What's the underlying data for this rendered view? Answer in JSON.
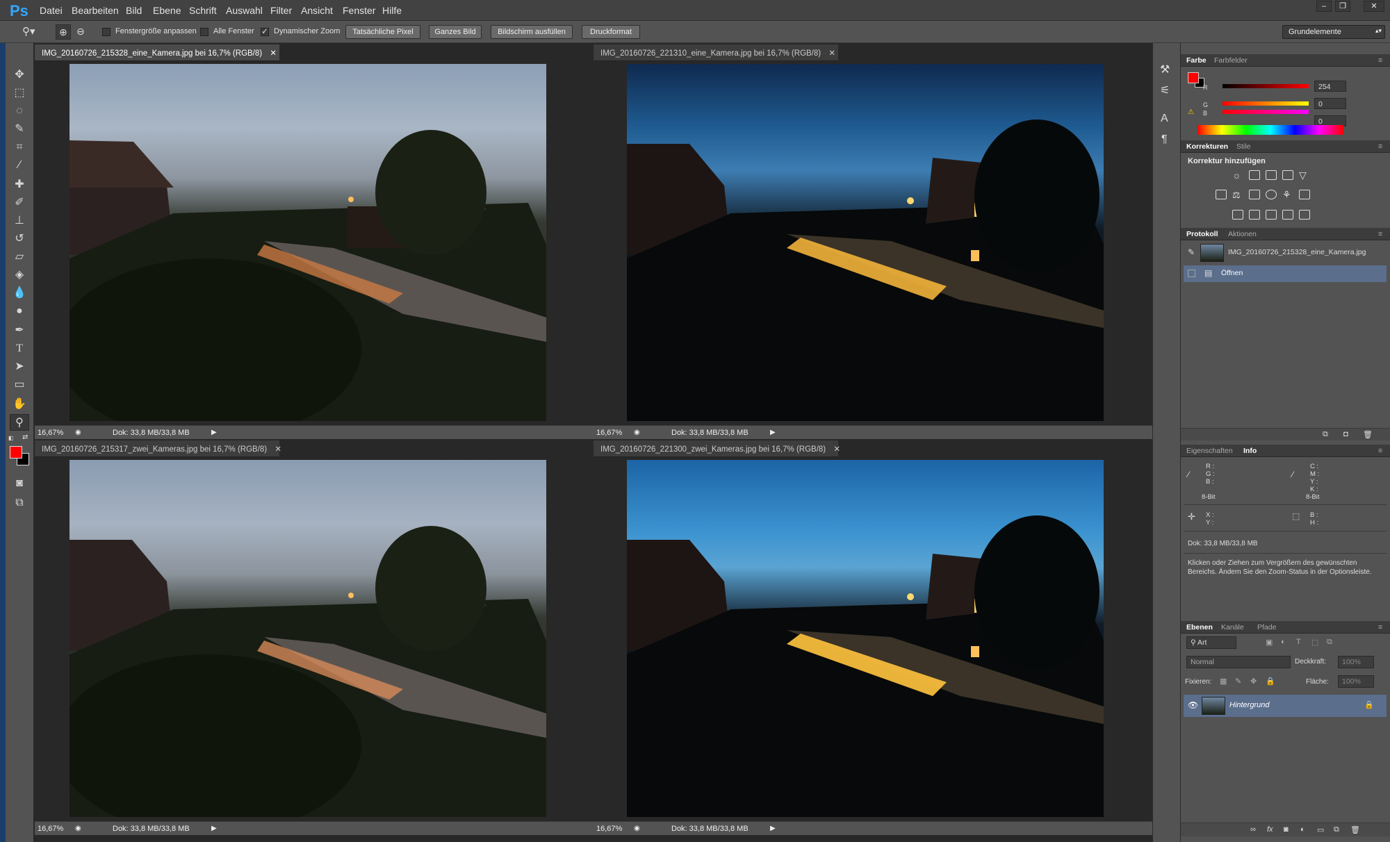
{
  "app": {
    "logo": "Ps"
  },
  "menu": [
    "Datei",
    "Bearbeiten",
    "Bild",
    "Ebene",
    "Schrift",
    "Auswahl",
    "Filter",
    "Ansicht",
    "Fenster",
    "Hilfe"
  ],
  "options": {
    "fit_window": "Fenstergröße anpassen",
    "all_windows": "Alle Fenster",
    "scrubby_zoom": "Dynamischer Zoom",
    "actual_pixels": "Tatsächliche Pixel",
    "fit_screen": "Ganzes Bild",
    "fill_screen": "Bildschirm ausfüllen",
    "print_size": "Druckformat",
    "workspace": "Grundelemente"
  },
  "documents": [
    {
      "title": "IMG_20160726_215328_eine_Kamera.jpg bei 16,7% (RGB/8)",
      "zoom": "16,67%",
      "doc": "Dok: 33,8 MB/33,8 MB"
    },
    {
      "title": "IMG_20160726_221310_eine_Kamera.jpg bei 16,7% (RGB/8)",
      "zoom": "16,67%",
      "doc": "Dok: 33,8 MB/33,8 MB"
    },
    {
      "title": "IMG_20160726_215317_zwei_Kameras.jpg bei 16,7% (RGB/8)",
      "zoom": "16,67%",
      "doc": "Dok: 33,8 MB/33,8 MB"
    },
    {
      "title": "IMG_20160726_221300_zwei_Kameras.jpg bei 16,7% (RGB/8)",
      "zoom": "16,67%",
      "doc": "Dok: 33,8 MB/33,8 MB"
    }
  ],
  "color_panel": {
    "tabs": [
      "Farbe",
      "Farbfelder"
    ],
    "r_label": "R",
    "g_label": "G",
    "b_label": "B",
    "r": "254",
    "g": "0",
    "b": "0"
  },
  "adjust_panel": {
    "tabs": [
      "Korrekturen",
      "Stile"
    ],
    "heading": "Korrektur hinzufügen"
  },
  "history_panel": {
    "tabs": [
      "Protokoll",
      "Aktionen"
    ],
    "snapshot": "IMG_20160726_215328_eine_Kamera.jpg",
    "step": "Öffnen"
  },
  "info_panel": {
    "tabs": [
      "Eigenschaften",
      "Info"
    ],
    "rgb": [
      "R :",
      "G :",
      "B :"
    ],
    "cmyk": [
      "C :",
      "M :",
      "Y :",
      "K :"
    ],
    "bit1": "8-Bit",
    "bit2": "8-Bit",
    "xy": [
      "X :",
      "Y :"
    ],
    "bh": [
      "B :",
      "H :"
    ],
    "doc": "Dok: 33,8 MB/33,8 MB",
    "help": "Klicken oder Ziehen zum Vergrößern des gewünschten Bereichs. Ändern Sie den Zoom-Status in der Optionsleiste."
  },
  "layers_panel": {
    "tabs": [
      "Ebenen",
      "Kanäle",
      "Pfade"
    ],
    "filter": "Art",
    "blend": "Normal",
    "opacity_label": "Deckkraft:",
    "opacity": "100%",
    "lock_label": "Fixieren:",
    "fill_label": "Fläche:",
    "fill": "100%",
    "layer_name": "Hintergrund"
  },
  "colors": {
    "accent": "#31a8ff",
    "foreground": "#fe0000",
    "selection": "#5b6e8c"
  }
}
